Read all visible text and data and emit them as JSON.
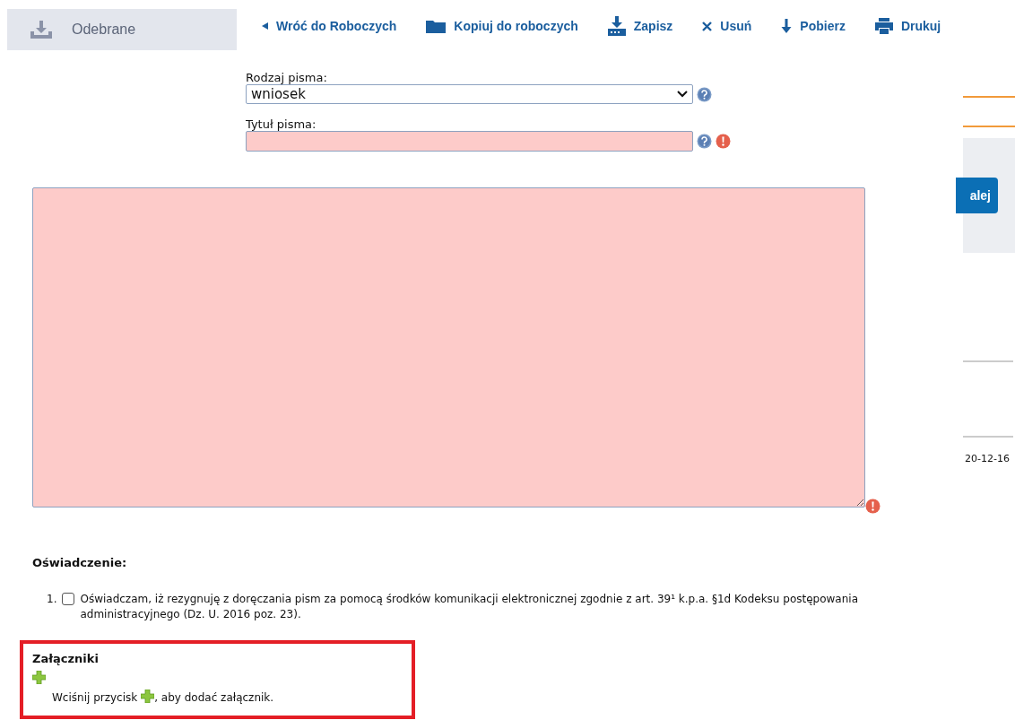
{
  "tab": {
    "label": "Odebrane"
  },
  "toolbar": [
    {
      "kind": "back",
      "label": "Wróć do Roboczych"
    },
    {
      "kind": "copy",
      "label": "Kopiuj do roboczych"
    },
    {
      "kind": "save",
      "label": "Zapisz"
    },
    {
      "kind": "delete",
      "label": "Usuń"
    },
    {
      "kind": "download",
      "label": "Pobierz"
    },
    {
      "kind": "print",
      "label": "Drukuj"
    }
  ],
  "form": {
    "type_label": "Rodzaj pisma:",
    "type_value": "wniosek",
    "title_label": "Tytuł pisma:",
    "title_invalid": true,
    "body_invalid": true
  },
  "declaration": {
    "heading": "Oświadczenie:",
    "items": [
      {
        "number": "1.",
        "checked": false,
        "text": "Oświadczam, iż rezygnuję z doręczania pism za pomocą środków komunikacji elektronicznej zgodnie z art. 39¹ k.p.a. §1d Kodeksu postępowania administracyjnego (Dz. U. 2016 poz. 23)."
      }
    ]
  },
  "attachments": {
    "heading": "Załączniki",
    "highlighted": true,
    "hint_before": "Wciśnij przycisk",
    "hint_after": ", aby dodać załącznik."
  },
  "side": {
    "button": "alej",
    "date": "20-12-16"
  }
}
